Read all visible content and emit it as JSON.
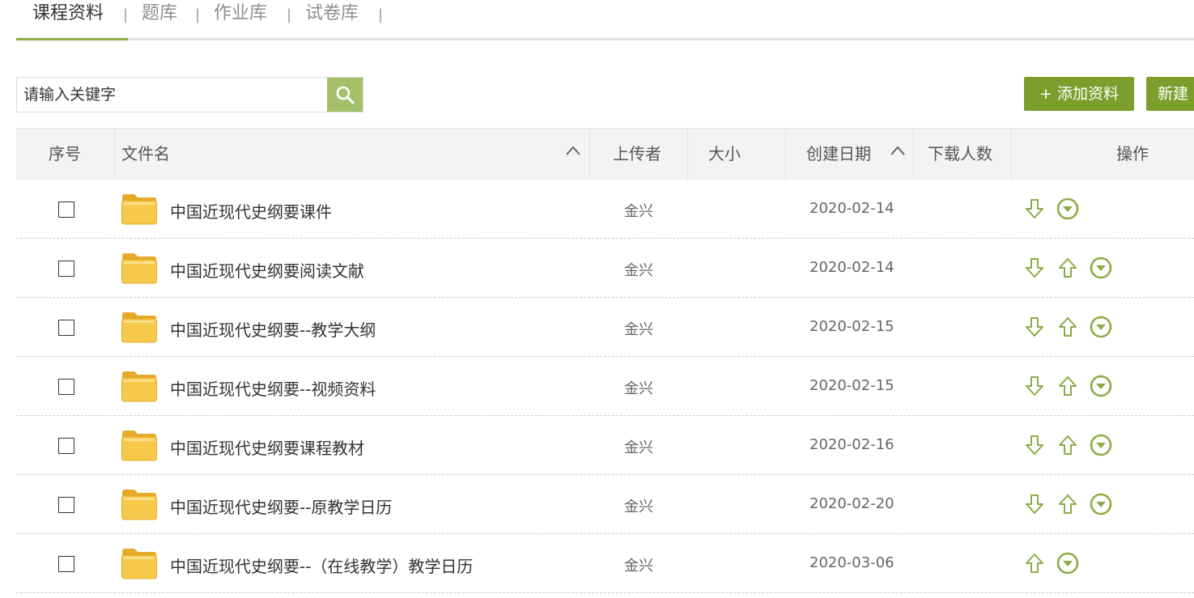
{
  "tabs": [
    {
      "label": "课程资料",
      "active": true
    },
    {
      "label": "题库",
      "active": false
    },
    {
      "label": "作业库",
      "active": false
    },
    {
      "label": "试卷库",
      "active": false
    }
  ],
  "tab_separator": "|",
  "search": {
    "placeholder": "请输入关键字",
    "icon": "search-icon"
  },
  "toolbar": {
    "add_label": "+ 添加资料",
    "new_label": "新建"
  },
  "table": {
    "headers": {
      "index": "序号",
      "filename": "文件名",
      "uploader": "上传者",
      "size": "大小",
      "created": "创建日期",
      "downloads": "下载人数",
      "actions": "操作"
    },
    "rows": [
      {
        "name": "中国近现代史纲要课件",
        "uploader": "金兴",
        "date": "2020-02-14",
        "actions": [
          "download",
          "more"
        ]
      },
      {
        "name": "中国近现代史纲要阅读文献",
        "uploader": "金兴",
        "date": "2020-02-14",
        "actions": [
          "download",
          "upload",
          "more"
        ]
      },
      {
        "name": "中国近现代史纲要--教学大纲",
        "uploader": "金兴",
        "date": "2020-02-15",
        "actions": [
          "download",
          "upload",
          "more"
        ]
      },
      {
        "name": "中国近现代史纲要--视频资料",
        "uploader": "金兴",
        "date": "2020-02-15",
        "actions": [
          "download",
          "upload",
          "more"
        ]
      },
      {
        "name": "中国近现代史纲要课程教材",
        "uploader": "金兴",
        "date": "2020-02-16",
        "actions": [
          "download",
          "upload",
          "more"
        ]
      },
      {
        "name": "中国近现代史纲要--原教学日历",
        "uploader": "金兴",
        "date": "2020-02-20",
        "actions": [
          "download",
          "upload",
          "more"
        ]
      },
      {
        "name": "中国近现代史纲要--（在线教学）教学日历",
        "uploader": "金兴",
        "date": "2020-03-06",
        "actions": [
          "upload",
          "more"
        ]
      }
    ]
  },
  "colors": {
    "accent": "#7b9e2c",
    "search_button": "#a4c16a",
    "icon": "#8cab45",
    "folder": "#f7c94a"
  }
}
